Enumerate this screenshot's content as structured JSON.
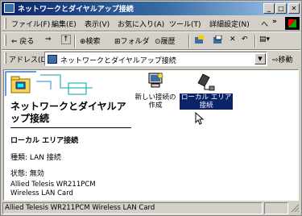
{
  "window": {
    "title": "ネットワークとダイヤルアップ接続",
    "controls": [
      "minimize",
      "maximize",
      "close"
    ]
  },
  "menu": {
    "items": [
      "ファイル(F)",
      "編集(E)",
      "表示(V)",
      "お気に入り(A)",
      "ツール(T)",
      "詳細設定(N)",
      "ヘ"
    ],
    "overflow": "»"
  },
  "toolbar": {
    "back": "⇐ 戻る",
    "forward": "⇒",
    "up": "↑",
    "search": "検索",
    "folders": "フォルダ",
    "history": "履歴",
    "views": "▤▾"
  },
  "address": {
    "label": "アドレス(D)",
    "value": "ネットワークとダイヤルアップ接続",
    "go": "移動"
  },
  "left_pane": {
    "title": "ネットワークとダイヤルアップ接続",
    "selected_name": "ローカル エリア接続",
    "type_line": "種類: LAN 接続",
    "status_line": "状態: 無効",
    "device_line1": "Allied Telesis WR211PCM",
    "device_line2": "Wireless LAN Card"
  },
  "icons": [
    {
      "label_line1": "新しい接続の",
      "label_line2": "作成"
    },
    {
      "label_line1": "ローカル エリア",
      "label_line2": "接続"
    }
  ],
  "status_bar": {
    "text": "Allied Telesis WR211PCM Wireless LAN Card"
  }
}
